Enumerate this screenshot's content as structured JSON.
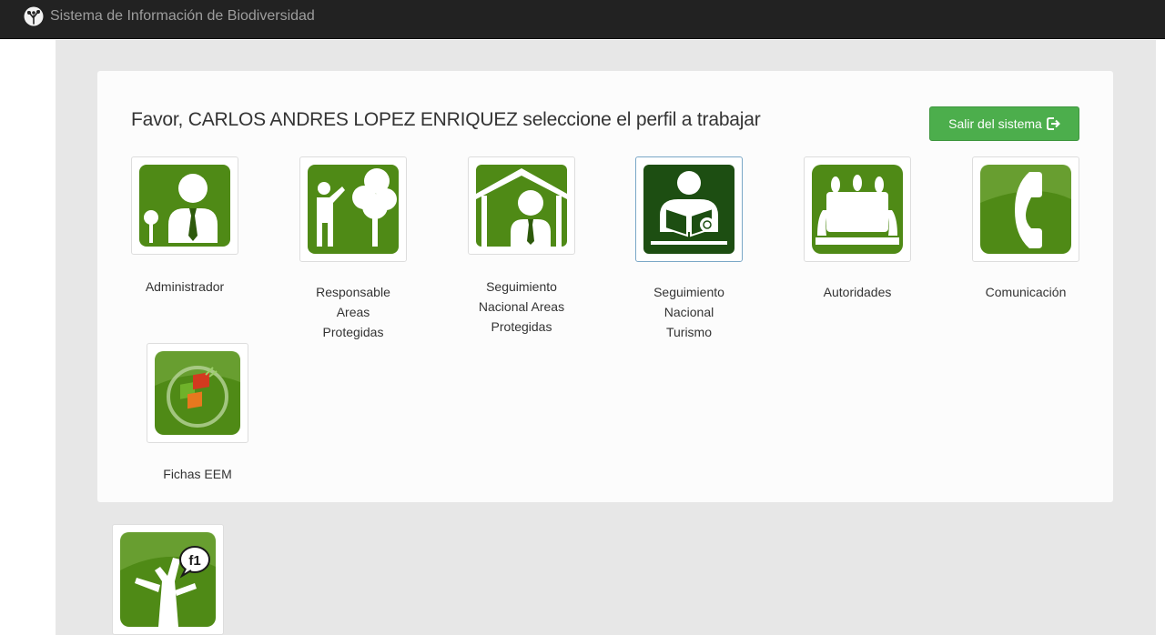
{
  "app": {
    "title": "Sistema de Información de Biodiversidad"
  },
  "greeting": "Favor, CARLOS ANDRES LOPEZ ENRIQUEZ seleccione el perfil a trabajar",
  "logout": {
    "label": "Salir del sistema",
    "icon": "logout-icon"
  },
  "colors": {
    "green": "#4f8a16",
    "green_dark": "#1d4e12",
    "button": "#4cae4c",
    "navbar": "#222222"
  },
  "profiles": [
    {
      "label": "Administrador",
      "icon": "administrator-icon"
    },
    {
      "label": "Responsable Areas Protegidas",
      "icon": "protected-area-manager-icon"
    },
    {
      "label": "Seguimiento Nacional Areas Protegidas",
      "icon": "protected-area-monitoring-icon"
    },
    {
      "label": "Seguimiento Nacional Turismo",
      "icon": "tourism-monitoring-icon",
      "selected": true
    },
    {
      "label": "Autoridades",
      "icon": "authorities-meeting-icon"
    },
    {
      "label": "Comunicación",
      "icon": "phone-icon"
    },
    {
      "label": "Fichas EEM",
      "icon": "eem-records-icon"
    }
  ],
  "footer_app": {
    "icon": "tree-f1-icon",
    "badge": "f1"
  }
}
